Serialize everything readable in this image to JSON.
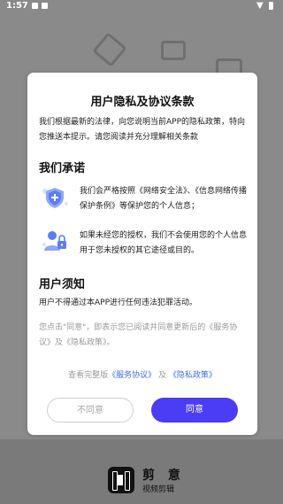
{
  "status_bar": {
    "time": "1:57"
  },
  "app": {
    "name": "剪 意",
    "subtitle": "视频剪辑"
  },
  "dialog": {
    "title": "用户隐私及协议条款",
    "intro": "我们根据最新的法律，向您说明当前APP的隐私政策，特向您推送本提示。请您阅读并充分理解相关条款",
    "promise_heading": "我们承诺",
    "promises": [
      {
        "icon": "shield-icon",
        "text": "我们会严格按照《网络安全法》、《信息网络传播保护条例》等保护您的个人信息；"
      },
      {
        "icon": "user-lock-icon",
        "text": "如果未经您的授权，我们不会使用您的个人信息用于您未授权的其它途径或目的。"
      }
    ],
    "notice_heading": "用户须知",
    "notice_text": "用户不得通过本APP进行任何违法犯罪活动。",
    "consent_text": "您点击\"同意\"，即表示您已阅读并同意更新后的《服务协议》及《隐私政策》。",
    "links": {
      "prefix": "查看完整版",
      "service": "《服务协议》",
      "and": "及",
      "privacy": "《隐私政策》"
    },
    "disagree_label": "不同意",
    "agree_label": "同意"
  },
  "colors": {
    "accent": "#4b3cf5",
    "link": "#3f6ee8"
  }
}
